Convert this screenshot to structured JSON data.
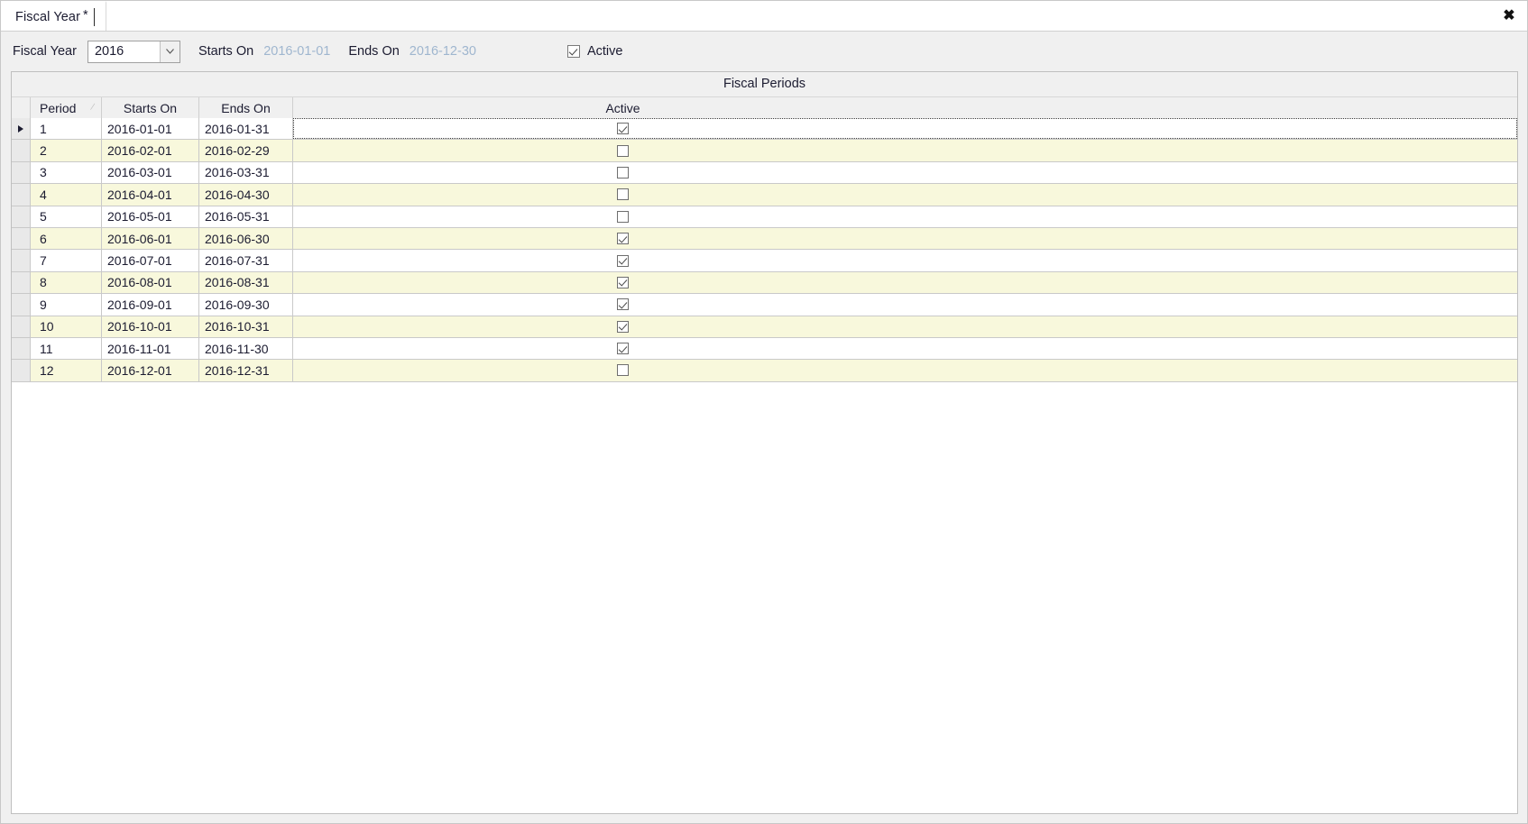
{
  "tab": {
    "label": "Fiscal Year",
    "dirty_marker": "*",
    "close_icon": "close-icon",
    "close_glyph": "✖"
  },
  "form": {
    "fiscal_year_label": "Fiscal Year",
    "fiscal_year_value": "2016",
    "starts_on_label": "Starts On",
    "starts_on_value": "2016-01-01",
    "ends_on_label": "Ends On",
    "ends_on_value": "2016-12-30",
    "active_label": "Active",
    "active_checked": true
  },
  "panel": {
    "title": "Fiscal Periods"
  },
  "grid": {
    "columns": [
      {
        "key": "period",
        "label": "Period",
        "sorted": true,
        "sort_glyph": "⁄"
      },
      {
        "key": "starts_on",
        "label": "Starts On"
      },
      {
        "key": "ends_on",
        "label": "Ends On"
      },
      {
        "key": "active",
        "label": "Active"
      }
    ],
    "rows": [
      {
        "period": "1",
        "starts_on": "2016-01-01",
        "ends_on": "2016-01-31",
        "active": true,
        "current": true
      },
      {
        "period": "2",
        "starts_on": "2016-02-01",
        "ends_on": "2016-02-29",
        "active": false,
        "current": false
      },
      {
        "period": "3",
        "starts_on": "2016-03-01",
        "ends_on": "2016-03-31",
        "active": false,
        "current": false
      },
      {
        "period": "4",
        "starts_on": "2016-04-01",
        "ends_on": "2016-04-30",
        "active": false,
        "current": false
      },
      {
        "period": "5",
        "starts_on": "2016-05-01",
        "ends_on": "2016-05-31",
        "active": false,
        "current": false
      },
      {
        "period": "6",
        "starts_on": "2016-06-01",
        "ends_on": "2016-06-30",
        "active": true,
        "current": false
      },
      {
        "period": "7",
        "starts_on": "2016-07-01",
        "ends_on": "2016-07-31",
        "active": true,
        "current": false
      },
      {
        "period": "8",
        "starts_on": "2016-08-01",
        "ends_on": "2016-08-31",
        "active": true,
        "current": false
      },
      {
        "period": "9",
        "starts_on": "2016-09-01",
        "ends_on": "2016-09-30",
        "active": true,
        "current": false
      },
      {
        "period": "10",
        "starts_on": "2016-10-01",
        "ends_on": "2016-10-31",
        "active": true,
        "current": false
      },
      {
        "period": "11",
        "starts_on": "2016-11-01",
        "ends_on": "2016-11-30",
        "active": true,
        "current": false
      },
      {
        "period": "12",
        "starts_on": "2016-12-01",
        "ends_on": "2016-12-31",
        "active": false,
        "current": false
      }
    ]
  },
  "colors": {
    "window_bg": "#f0f0f0",
    "alt_row": "#f8f8dc",
    "readonly_text": "#9fb6cf",
    "text": "#1b1b30",
    "grid_line": "#c9c9c9"
  }
}
